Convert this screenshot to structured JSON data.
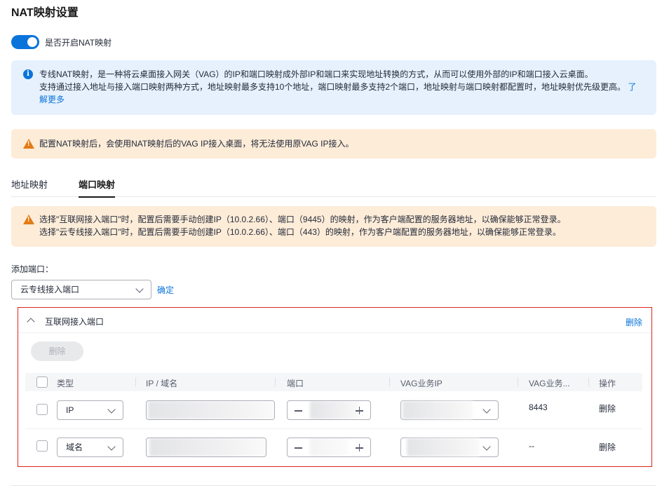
{
  "page": {
    "title": "NAT映射设置"
  },
  "toggle": {
    "label": "是否开启NAT映射",
    "on": true
  },
  "info": {
    "line1": "专线NAT映射，是一种将云桌面接入网关（VAG）的IP和端口映射成外部IP和端口来实现地址转换的方式，从而可以使用外部的IP和端口接入云桌面。",
    "line2": "支持通过接入地址与接入端口映射两种方式，地址映射最多支持10个地址，端口映射最多支持2个端口，地址映射与端口映射都配置时，地址映射优先级更高。",
    "link_a": "了",
    "link_b": "解更多"
  },
  "warning_top": "配置NAT映射后，会使用NAT映射后的VAG IP接入桌面，将无法使用原VAG IP接入。",
  "tabs": [
    {
      "label": "地址映射",
      "active": false
    },
    {
      "label": "端口映射",
      "active": true
    }
  ],
  "warning_port": {
    "line1": "选择\"互联网接入端口\"时，配置后需要手动创建IP（10.0.2.66）、端口（9445）的映射，作为客户端配置的服务器地址，以确保能够正常登录。",
    "line2": "选择\"云专线接入端口\"时，配置后需要手动创建IP（10.0.2.66）、端口（443）的映射，作为客户端配置的服务器地址，以确保能够正常登录。"
  },
  "add_port": {
    "label": "添加端口：",
    "selected": "云专线接入端口",
    "confirm": "确定"
  },
  "panel": {
    "title": "互联网接入端口",
    "delete": "删除",
    "batch_delete": "删除",
    "columns": [
      "类型",
      "IP / 域名",
      "端口",
      "VAG业务IP",
      "VAG业务...",
      "操作"
    ],
    "rows": [
      {
        "type": "IP",
        "vag_port": "8443",
        "action": "删除"
      },
      {
        "type": "域名",
        "vag_port": "--",
        "action": "删除"
      }
    ]
  },
  "colors": {
    "primary": "#0a74da",
    "warning": "#e27b16",
    "highlight_border": "#d9251c"
  }
}
